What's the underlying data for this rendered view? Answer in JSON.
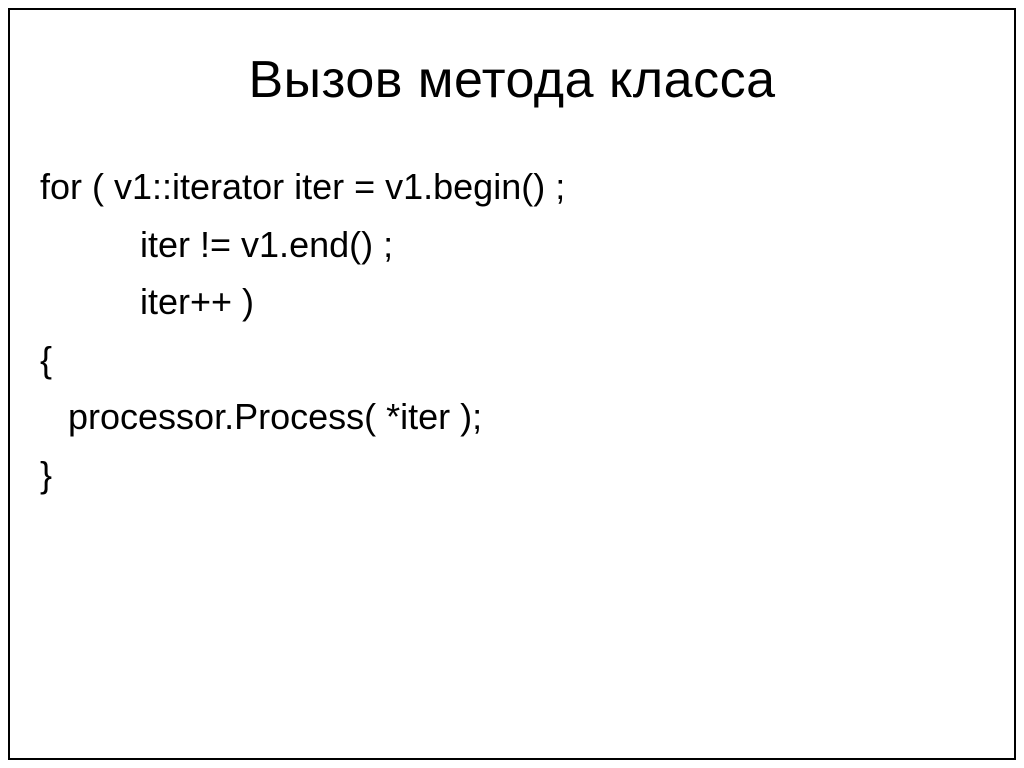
{
  "title": "Вызов метода класса",
  "code": {
    "line1": "for ( v1::iterator iter = v1.begin() ;",
    "line2": "iter != v1.end() ;",
    "line3": "iter++ )",
    "line4": "{",
    "line5": "processor.Process( *iter );",
    "line6": "}"
  }
}
